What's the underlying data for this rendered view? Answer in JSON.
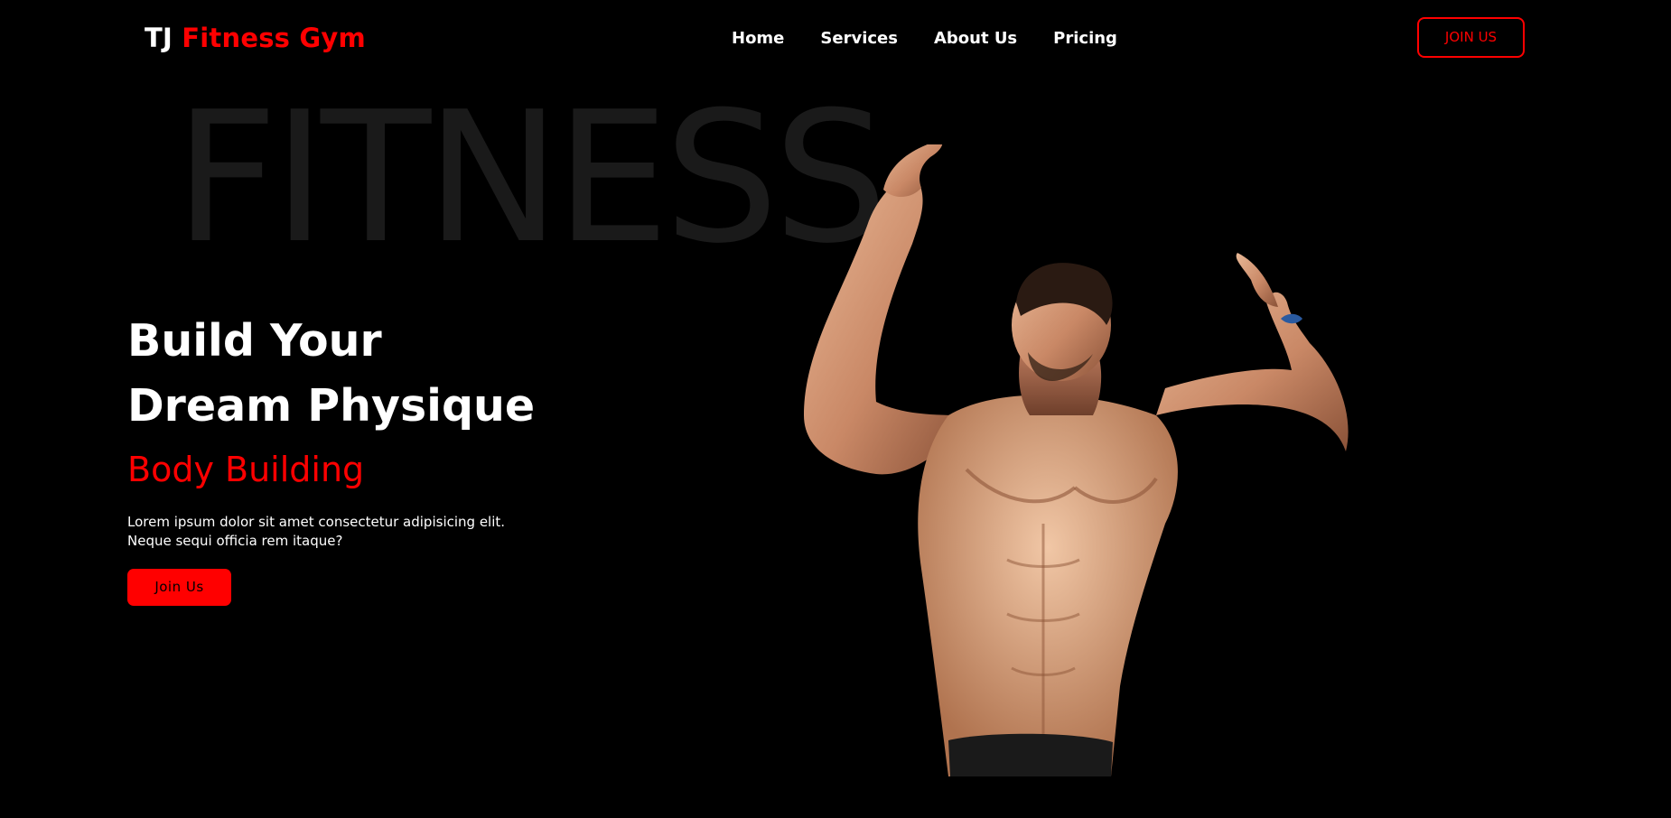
{
  "header": {
    "logo_part1": "TJ",
    "logo_part2": "Fitness Gym",
    "nav": [
      "Home",
      "Services",
      "About Us",
      "Pricing"
    ],
    "join_button": "JOIN US"
  },
  "hero": {
    "background_word": "FITNESS",
    "title_line1": "Build Your",
    "title_line2": "Dream Physique",
    "subtitle": "Body Building",
    "description_line1": "Lorem ipsum dolor sit amet consectetur adipisicing elit.",
    "description_line2": "Neque sequi officia rem itaque?",
    "cta_button": "Join Us"
  },
  "colors": {
    "background": "#000000",
    "accent": "#ff0000",
    "text": "#ffffff",
    "faint_word": "#1a1a1a"
  }
}
